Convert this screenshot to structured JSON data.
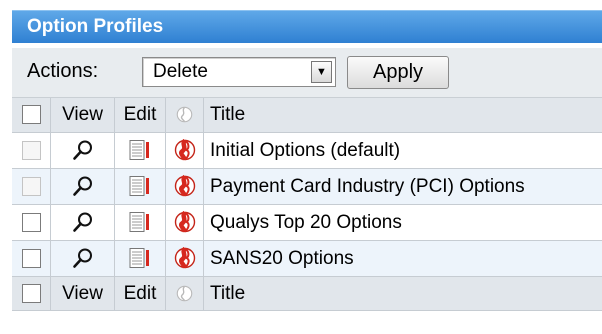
{
  "panel": {
    "title": "Option Profiles"
  },
  "actions": {
    "label": "Actions:",
    "selected": "Delete",
    "apply_label": "Apply"
  },
  "table": {
    "columns": {
      "view": "View",
      "edit": "Edit",
      "title": "Title"
    },
    "rows": [
      {
        "title": "Initial Options (default)",
        "checkbox_enabled": false
      },
      {
        "title": "Payment Card Industry (PCI) Options",
        "checkbox_enabled": false
      },
      {
        "title": "Qualys Top 20 Options",
        "checkbox_enabled": true
      },
      {
        "title": "SANS20 Options",
        "checkbox_enabled": true
      }
    ]
  },
  "icons": {
    "view": "magnifier-icon",
    "edit": "edit-form-icon",
    "globe": "globe-icon"
  },
  "colors": {
    "header_blue": "#2f80d2",
    "alt_row": "#edf4fb",
    "globe_red": "#d6281e"
  }
}
